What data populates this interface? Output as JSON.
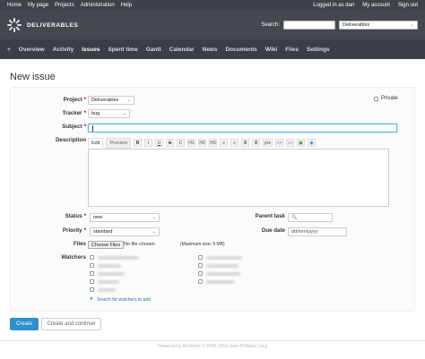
{
  "top_menu": {
    "left": [
      "Home",
      "My page",
      "Projects",
      "Administration",
      "Help"
    ],
    "logged_prefix": "Logged in as ",
    "user": "dan",
    "right": [
      "My account",
      "Sign out"
    ]
  },
  "header": {
    "title": "DELIVERABLES",
    "search_label": "Search:",
    "search_value": "",
    "project_jump": "Deliverables"
  },
  "main_menu": {
    "plus": "+",
    "items": [
      "Overview",
      "Activity",
      "Issues",
      "Spent time",
      "Gantt",
      "Calendar",
      "News",
      "Documents",
      "Wiki",
      "Files",
      "Settings"
    ],
    "selected": "Issues"
  },
  "page_title": "New issue",
  "form": {
    "project_label": "Project",
    "project_value": "Deliverables",
    "private_label": "Private",
    "tracker_label": "Tracker",
    "tracker_value": "bug",
    "subject_label": "Subject",
    "subject_value": "",
    "description_label": "Description",
    "editor_tabs": [
      "Edit",
      "Preview"
    ],
    "toolbar": [
      "B",
      "I",
      "U",
      "S",
      "C",
      "H1",
      "H2",
      "H3",
      "≡",
      "≡",
      "≣",
      "≣",
      "pre",
      "<>",
      "▭",
      "▣",
      "◉"
    ],
    "status_label": "Status",
    "status_value": "new",
    "priority_label": "Priority",
    "priority_value": "standard",
    "parent_label": "Parent task",
    "due_label": "Due date",
    "due_placeholder": "dd/mm/yyyy",
    "files_label": "Files",
    "choose_files": "Choose Files",
    "no_file": "No file chosen",
    "max_size": "(Maximum size: 5 MB)",
    "watchers_label": "Watchers",
    "search_watchers": "Search for watchers to add"
  },
  "buttons": {
    "create": "Create",
    "create_continue": "Create and continue"
  },
  "footer": "Powered by Redmine © 2006-2019 Jean-Philippe Lang",
  "colors": {
    "top_menu_bg": "#3e4349",
    "header_bg": "#45494f",
    "main_menu_bg": "#3a3f46",
    "primary_button": "#2f8fd0",
    "required_mark": "#bb0000"
  }
}
